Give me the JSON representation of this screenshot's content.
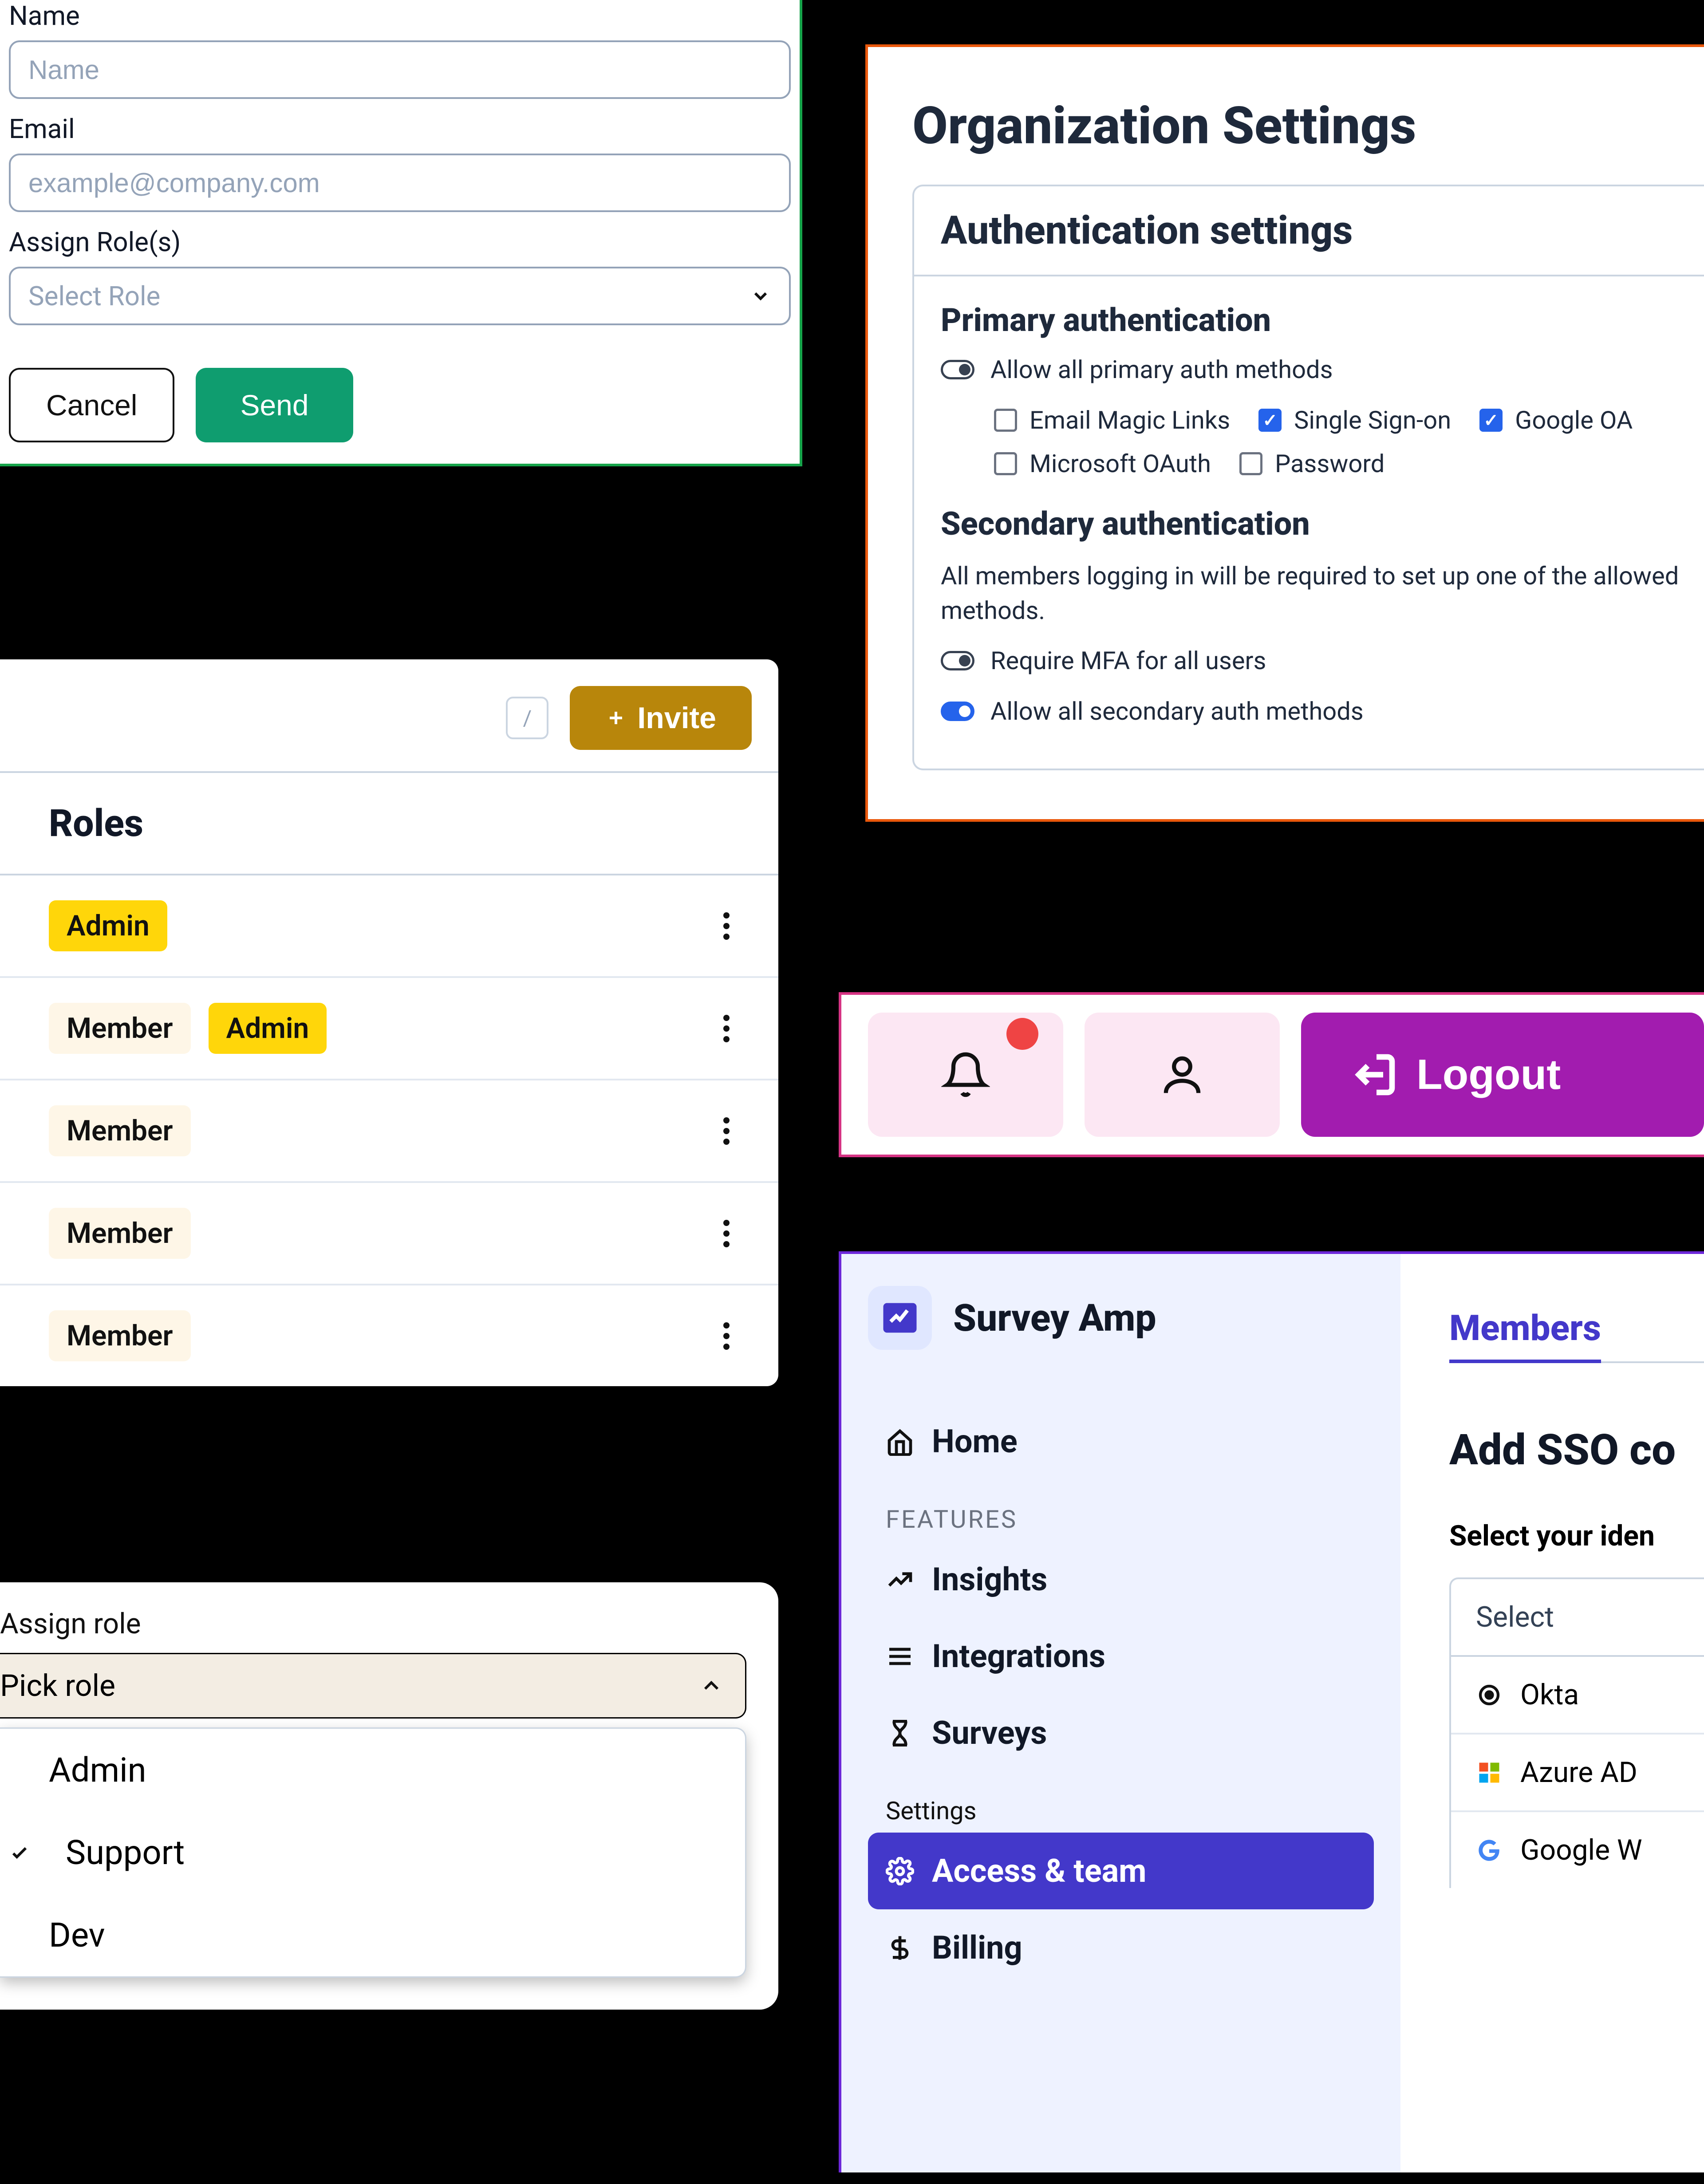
{
  "invite_form": {
    "name_label": "Name",
    "name_placeholder": "Name",
    "email_label": "Email",
    "email_placeholder": "example@company.com",
    "roles_label": "Assign Role(s)",
    "roles_placeholder": "Select Role",
    "cancel": "Cancel",
    "send": "Send"
  },
  "org_settings": {
    "title": "Organization Settings",
    "auth_title": "Authentication settings",
    "primary_heading": "Primary authentication",
    "allow_primary": "Allow all primary auth methods",
    "methods": {
      "magic_links": "Email Magic Links",
      "sso": "Single Sign-on",
      "google": "Google OA",
      "microsoft": "Microsoft OAuth",
      "password": "Password"
    },
    "secondary_heading": "Secondary authentication",
    "secondary_desc": "All members logging in will be required to set up one of the allowed methods.",
    "require_mfa": "Require MFA for all users",
    "allow_secondary": "Allow all secondary auth methods"
  },
  "roles_panel": {
    "slash": "/",
    "invite_label": "Invite",
    "heading": "Roles",
    "rows": [
      [
        "Admin"
      ],
      [
        "Member",
        "Admin"
      ],
      [
        "Member"
      ],
      [
        "Member"
      ],
      [
        "Member"
      ]
    ]
  },
  "action_bar": {
    "logout": "Logout"
  },
  "assign_role": {
    "label": "Assign role",
    "placeholder": "Pick role",
    "options": [
      "Admin",
      "Support",
      "Dev"
    ],
    "selected": "Support"
  },
  "survey_amp": {
    "brand": "Survey Amp",
    "nav": {
      "home": "Home",
      "features_header": "FEATURES",
      "insights": "Insights",
      "integrations": "Integrations",
      "surveys": "Surveys",
      "settings_header": "Settings",
      "access_team": "Access & team",
      "billing": "Billing"
    },
    "members_tab": "Members",
    "sso_title": "Add SSO co",
    "idp_label": "Select your iden",
    "idp_placeholder": "Select",
    "idp_options": {
      "okta": "Okta",
      "azure": "Azure AD",
      "google": "Google W"
    }
  }
}
